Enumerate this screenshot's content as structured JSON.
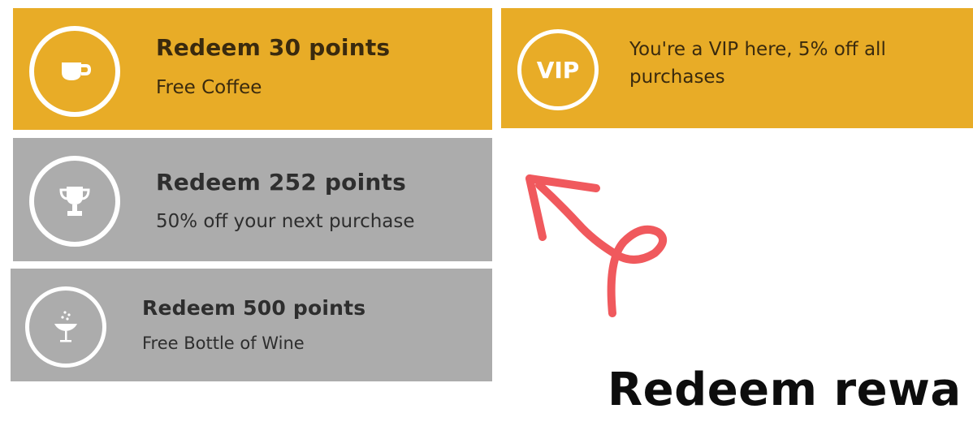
{
  "rewards": [
    {
      "title": "Redeem 30 points",
      "subtitle": "Free Coffee",
      "icon": "coffee-cup-icon",
      "status": "available",
      "color": "#e8ac27"
    },
    {
      "title": "Redeem 252 points",
      "subtitle": "50% off your next purchase",
      "icon": "trophy-icon",
      "status": "locked",
      "color": "#acacac"
    },
    {
      "title": "Redeem 500 points",
      "subtitle": "Free Bottle of Wine",
      "icon": "champagne-glass-icon",
      "status": "locked",
      "color": "#acacac"
    }
  ],
  "vip": {
    "badge_label": "VIP",
    "text": "You're a VIP here, 5% off all purchases",
    "color": "#e8ac27"
  },
  "annotation": {
    "arrow_color": "#f0595d",
    "caption": "Redeem rewa"
  }
}
